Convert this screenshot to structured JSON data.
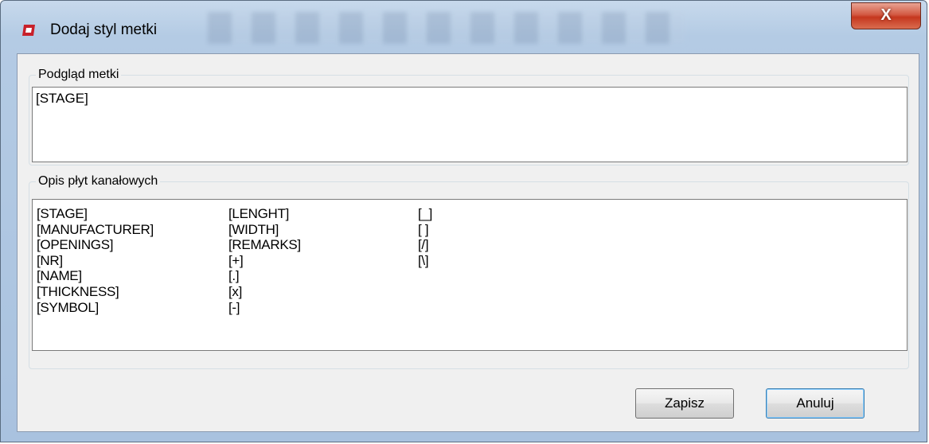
{
  "window": {
    "title": "Dodaj styl metki",
    "close_label": "X"
  },
  "preview": {
    "legend": "Podgląd metki",
    "value": "[STAGE]"
  },
  "description": {
    "legend": "Opis płyt kanałowych",
    "columns": [
      [
        "[STAGE]",
        "[MANUFACTURER]",
        "[OPENINGS]",
        "[NR]",
        "[NAME]",
        "[THICKNESS]",
        "[SYMBOL]"
      ],
      [
        "[LENGHT]",
        "[WIDTH]",
        "[REMARKS]",
        "[+]",
        "[.]",
        "[x]",
        "[-]"
      ],
      [
        "[_]",
        "[ ]",
        "[/]",
        "[\\]"
      ]
    ]
  },
  "buttons": {
    "save": "Zapisz",
    "cancel": "Anuluj"
  },
  "colors": {
    "app_icon": "#c8202a",
    "close_button": "#c5371e"
  }
}
